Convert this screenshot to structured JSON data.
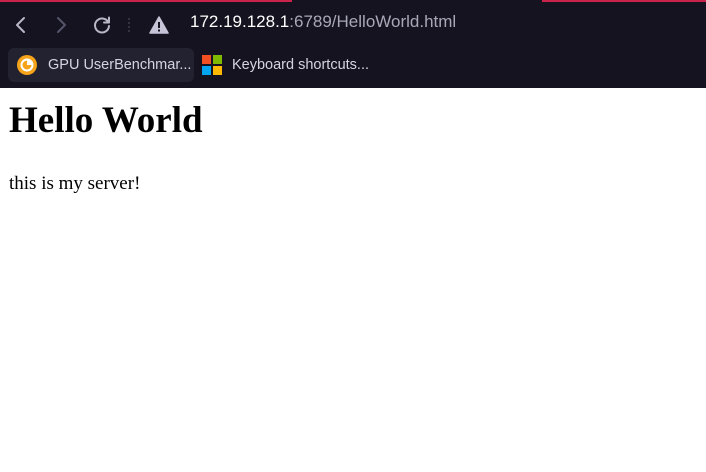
{
  "browser": {
    "address_bar": {
      "host": "172.19.128.1",
      "rest": ":6789/HelloWorld.html"
    },
    "security_icon": "warning-triangle-icon",
    "nav": {
      "back_icon": "chevron-left-icon",
      "forward_icon": "chevron-right-icon",
      "reload_icon": "reload-icon"
    },
    "bookmarks": [
      {
        "label": "GPU UserBenchmar...",
        "icon": "userbenchmark-icon"
      },
      {
        "label": "Keyboard shortcuts...",
        "icon": "microsoft-logo-icon"
      }
    ],
    "colors": {
      "chrome_bg": "#14131f",
      "accent": "#c8234a",
      "text": "#d6d4e2"
    }
  },
  "page": {
    "heading": "Hello World",
    "paragraph": "this is my server!"
  }
}
